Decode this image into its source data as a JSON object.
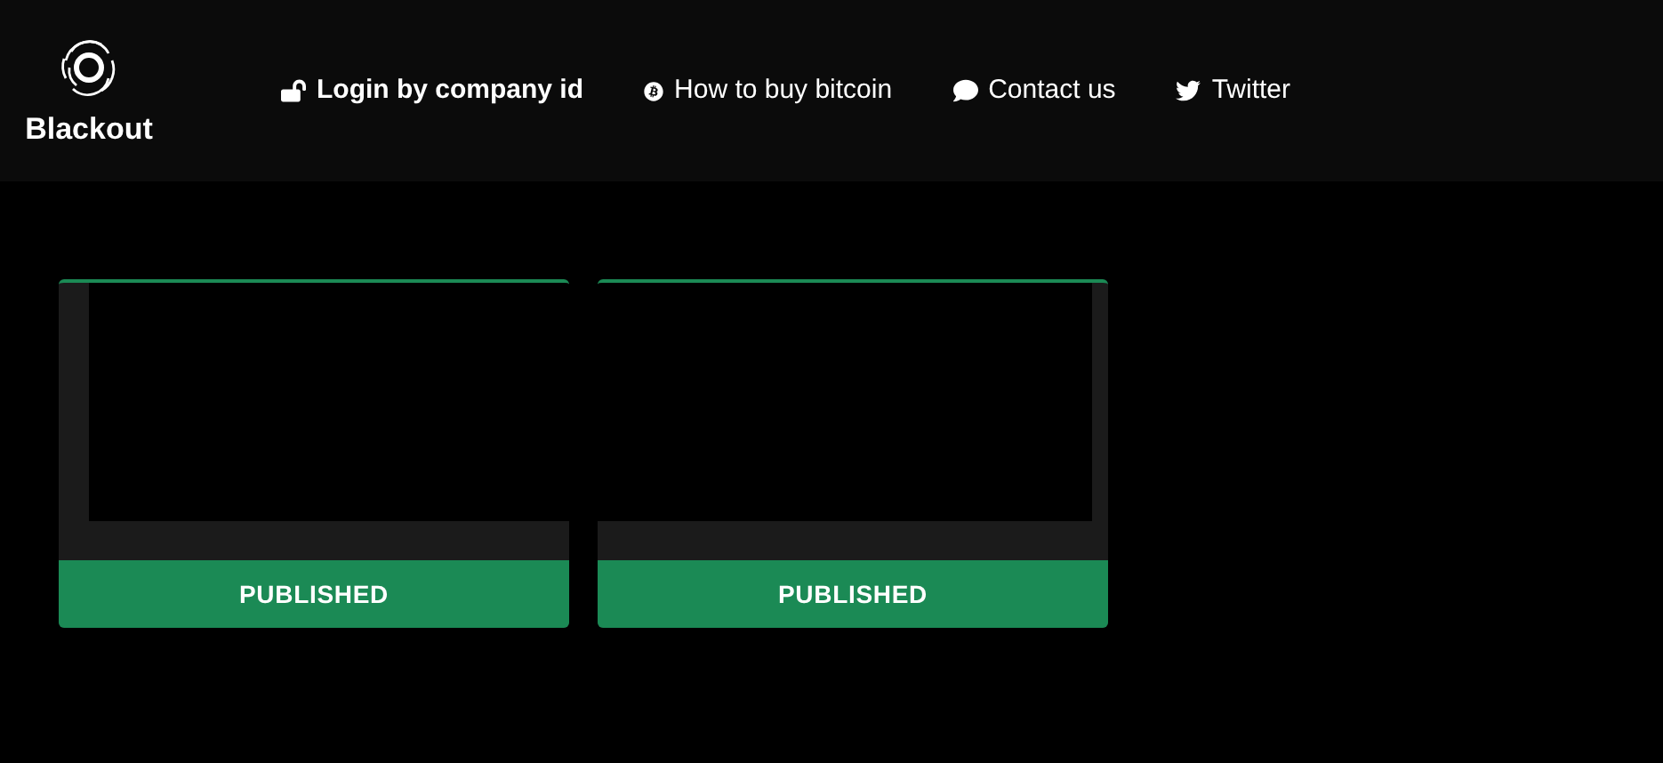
{
  "brand": {
    "name": "Blackout"
  },
  "nav": [
    {
      "kind": "login",
      "label": "Login by company id"
    },
    {
      "kind": "bitcoin",
      "label": "How to buy bitcoin"
    },
    {
      "kind": "contact",
      "label": "Contact us"
    },
    {
      "kind": "twitter",
      "label": "Twitter"
    }
  ],
  "cards": [
    {
      "kind": "covered_left",
      "status": "PUBLISHED"
    },
    {
      "kind": "covered_right",
      "status": "PUBLISHED"
    }
  ]
}
